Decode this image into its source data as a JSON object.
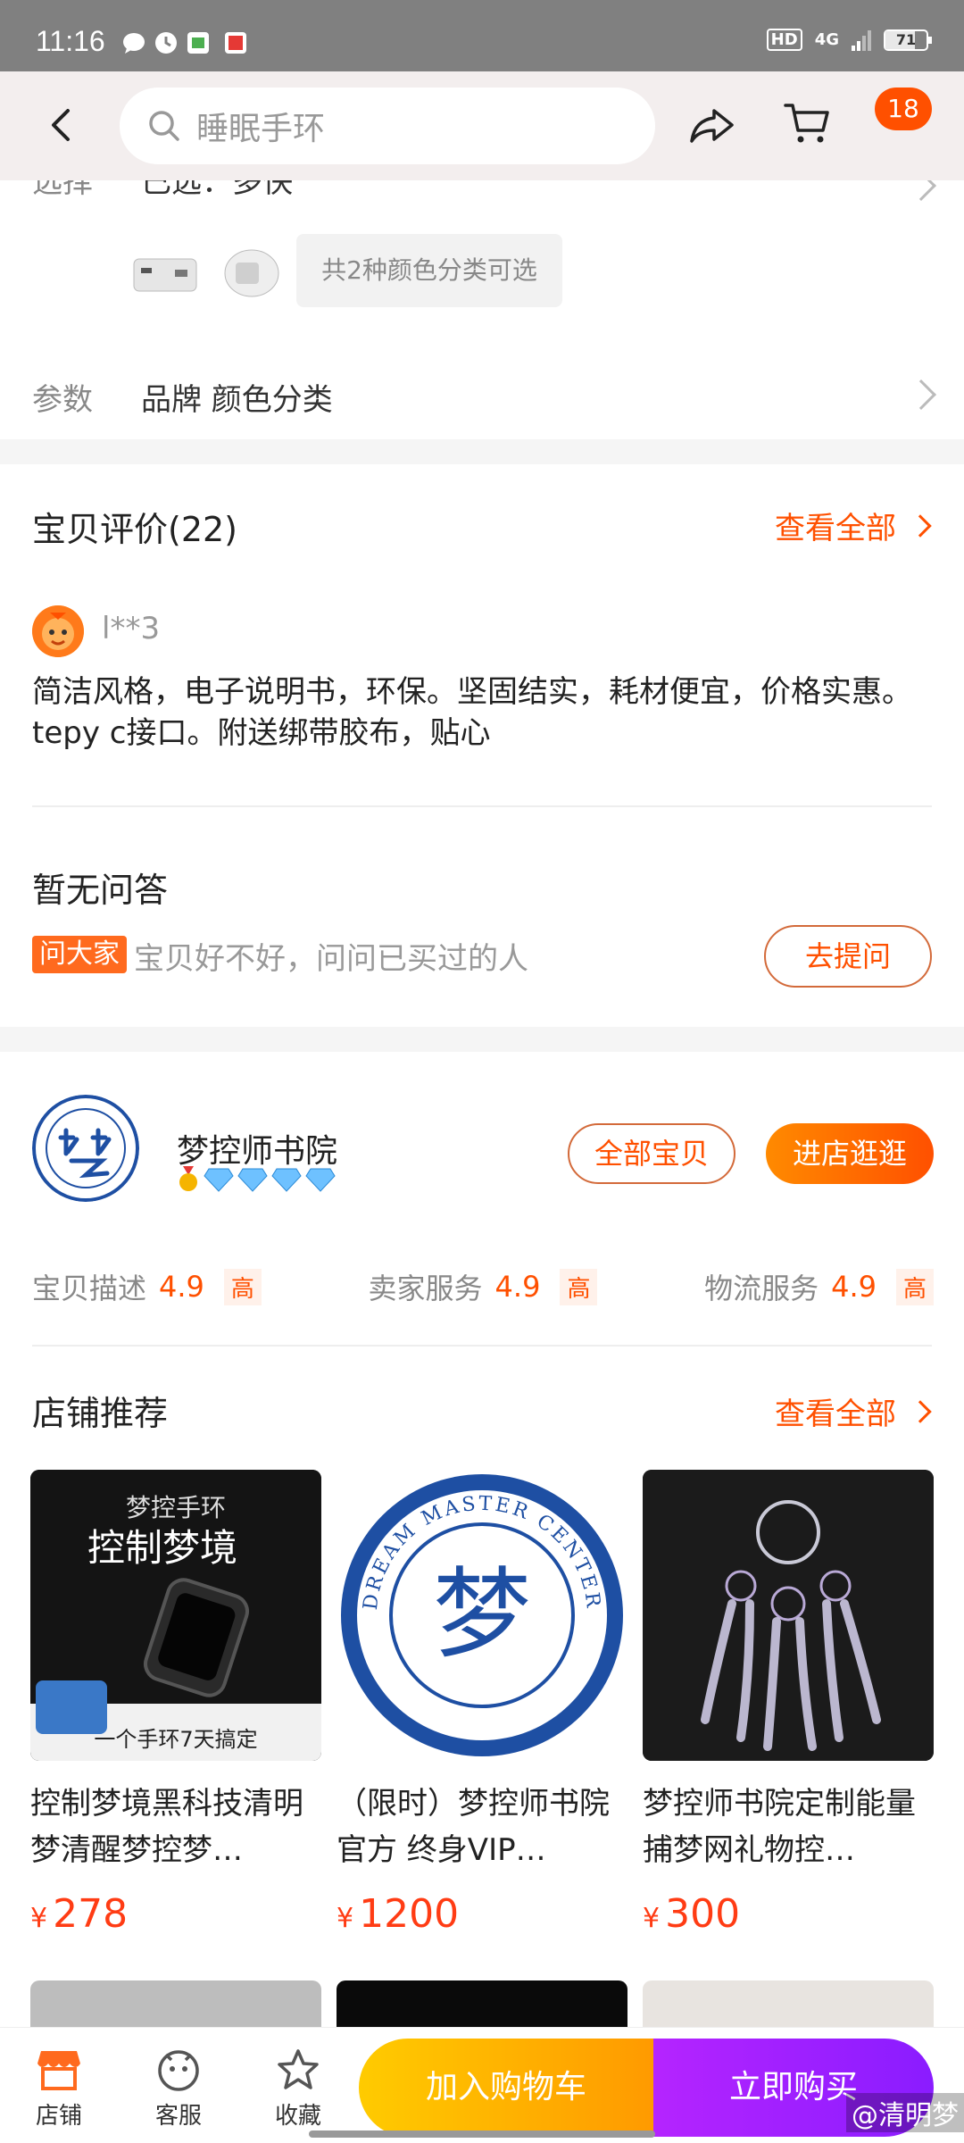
{
  "status_bar": {
    "time": "11:16",
    "network": "4G",
    "hd": "HD",
    "battery": "71",
    "battery_fraction": 0.71
  },
  "top_nav": {
    "search_placeholder": "睡眠手环",
    "cart_badge": "18"
  },
  "select_section": {
    "label": "选择",
    "value": "已选：多快",
    "color_options_text": "共2种颜色分类可选"
  },
  "params_section": {
    "label": "参数",
    "value": "品牌 颜色分类"
  },
  "reviews": {
    "title": "宝贝评价(22)",
    "see_all": "查看全部",
    "reviewer": "l**3",
    "text": "简洁风格，电子说明书，环保。坚固结实，耗材便宜，价格实惠。tepy c接口。附送绑带胶布，贴心"
  },
  "qa": {
    "title": "暂无问答",
    "tag": "问大家",
    "hint": "宝贝好不好，问问已买过的人",
    "ask_button": "去提问"
  },
  "shop": {
    "name": "梦控师书院",
    "all_items_button": "全部宝贝",
    "enter_shop_button": "进店逛逛",
    "scores": [
      {
        "label": "宝贝描述",
        "value": "4.9",
        "level": "高"
      },
      {
        "label": "卖家服务",
        "value": "4.9",
        "level": "高"
      },
      {
        "label": "物流服务",
        "value": "4.9",
        "level": "高"
      }
    ],
    "recommend_title": "店铺推荐",
    "recommend_see_all": "查看全部",
    "products": [
      {
        "title": "控制梦境黑科技清明梦清醒梦控梦…",
        "currency": "¥",
        "price": "278",
        "image_text_1": "梦控手环",
        "image_text_2": "控制梦境",
        "image_text_3": "一个手环7天搞定"
      },
      {
        "title": "（限时）梦控师书院官方 终身VIP…",
        "currency": "¥",
        "price": "1200",
        "image_text_1": "DREAM MASTER CENTER",
        "image_text_2": "梦"
      },
      {
        "title": "梦控师书院定制能量捕梦网礼物控…",
        "currency": "¥",
        "price": "300"
      }
    ]
  },
  "bottom_bar": {
    "tabs": [
      "店铺",
      "客服",
      "收藏"
    ],
    "add_to_cart": "加入购物车",
    "buy_now": "立即购买"
  },
  "watermark": "@清明梦"
}
